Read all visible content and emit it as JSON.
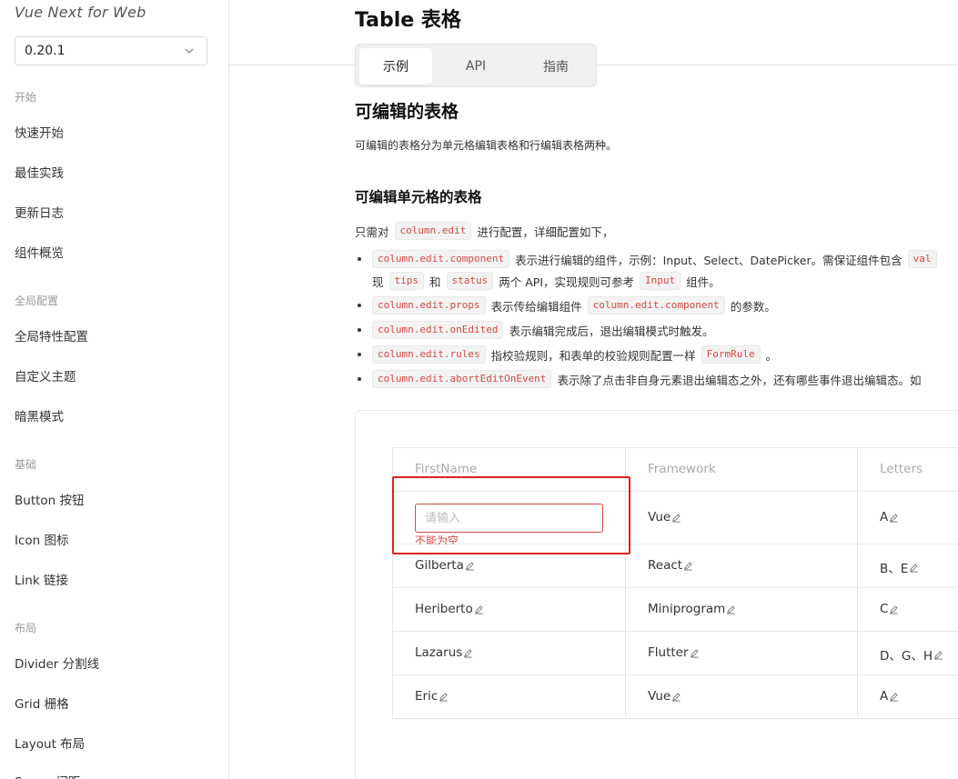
{
  "sidebar": {
    "logo": "Vue Next for Web",
    "version": "0.20.1",
    "groups": [
      {
        "label": "开始",
        "items": [
          "快速开始",
          "最佳实践",
          "更新日志",
          "组件概览"
        ]
      },
      {
        "label": "全局配置",
        "items": [
          "全局特性配置",
          "自定义主题",
          "暗黑模式"
        ]
      },
      {
        "label": "基础",
        "items": [
          "Button 按钮",
          "Icon 图标",
          "Link 链接"
        ]
      },
      {
        "label": "布局",
        "items": [
          "Divider 分割线",
          "Grid 栅格",
          "Layout 布局",
          "Space 间距"
        ]
      }
    ]
  },
  "page": {
    "title": "Table 表格",
    "tabs": [
      "示例",
      "API",
      "指南"
    ],
    "section_title": "可编辑的表格",
    "section_desc": "可编辑的表格分为单元格编辑表格和行编辑表格两种。",
    "sub_title": "可编辑单元格的表格",
    "intro": {
      "before": "只需对",
      "code": "column.edit",
      "after": "进行配置，详细配置如下，"
    },
    "bullets": [
      {
        "c1": "column.edit.component",
        "t1": "表示进行编辑的组件，示例：Input、Select、DatePicker。需保证组件包含",
        "c2": "val"
      },
      {
        "t0": "现",
        "c1": "tips",
        "t1": "和",
        "c2": "status",
        "t2": "两个 API，实现规则可参考",
        "c3": "Input",
        "t3": "组件。"
      },
      {
        "c1": "column.edit.props",
        "t1": "表示传给编辑组件",
        "c2": "column.edit.component",
        "t2": "的参数。"
      },
      {
        "c1": "column.edit.onEdited",
        "t1": "表示编辑完成后，退出编辑模式时触发。"
      },
      {
        "c1": "column.edit.rules",
        "t1": "指校验规则，和表单的校验规则配置一样",
        "c2": "FormRule",
        "t2": "。"
      },
      {
        "c1": "column.edit.abortEditOnEvent",
        "t1": "表示除了点击非自身元素退出编辑态之外，还有哪些事件退出编辑态。如"
      }
    ]
  },
  "table": {
    "columns": [
      "FirstName",
      "Framework",
      "Letters"
    ],
    "editing": {
      "placeholder": "请输入",
      "error": "不能为空"
    },
    "rows": [
      [
        "",
        "Vue",
        "A"
      ],
      [
        "Gilberta",
        "React",
        "B、E"
      ],
      [
        "Heriberto",
        "Miniprogram",
        "C"
      ],
      [
        "Lazarus",
        "Flutter",
        "D、G、H"
      ],
      [
        "Eric",
        "Vue",
        "A"
      ]
    ]
  },
  "icons": {
    "edit": "edit-pencil-icon",
    "select": "chevron-down-icon"
  },
  "colors": {
    "error": "#d54941",
    "highlight": "#e02020",
    "code_text": "#d54941"
  }
}
